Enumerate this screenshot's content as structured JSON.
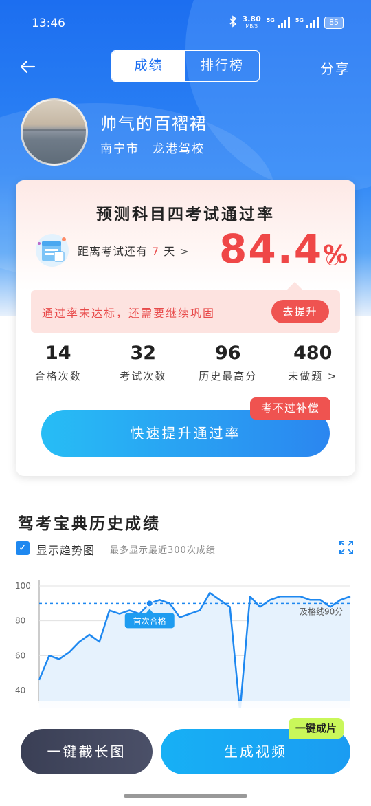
{
  "status_bar": {
    "time": "13:46",
    "net_speed": "3.80",
    "net_unit": "MB/S",
    "signal1_label": "5G",
    "signal2_label": "5G",
    "battery": "85"
  },
  "nav": {
    "tabs": [
      {
        "label": "成绩",
        "active": true
      },
      {
        "label": "排行榜",
        "active": false
      }
    ],
    "share_label": "分享"
  },
  "profile": {
    "name": "帅气的百褶裙",
    "location": "南宁市　龙港驾校"
  },
  "card": {
    "title": "预测科目四考试通过率",
    "countdown_prefix": "距离考试还有",
    "countdown_days": "7",
    "countdown_suffix": "天",
    "pass_rate": "84.4",
    "pass_rate_unit": "%",
    "warning_text": "通过率未达标，还需要继续巩固",
    "improve_button": "去提升",
    "stats": [
      {
        "value": "14",
        "label": "合格次数"
      },
      {
        "value": "32",
        "label": "考试次数"
      },
      {
        "value": "96",
        "label": "历史最高分"
      },
      {
        "value": "480",
        "label": "未做题"
      }
    ],
    "compensation_badge": "考不过补偿",
    "cta_label": "快速提升通过率"
  },
  "history": {
    "title": "驾考宝典历史成绩",
    "show_trend_label": "显示趋势图",
    "show_trend_checked": true,
    "note": "最多显示最近300次成绩"
  },
  "chart_data": {
    "type": "area",
    "y_ticks": [
      "100",
      "80",
      "60",
      "40"
    ],
    "ylim": [
      35,
      100
    ],
    "pass_line": 90,
    "pass_line_label": "及格线90分",
    "first_pass_label": "首次合格",
    "first_pass_index": 11,
    "values": [
      46,
      60,
      58,
      62,
      68,
      72,
      68,
      86,
      84,
      86,
      84,
      90,
      92,
      90,
      82,
      84,
      86,
      96,
      92,
      88,
      28,
      94,
      88,
      92,
      94,
      94,
      94,
      92,
      92,
      88,
      92,
      94
    ],
    "colors": {
      "line": "#1e88f0",
      "fill": "#e6f2fd",
      "pass_line": "#1e88f0",
      "grid": "#e0e0e0"
    }
  },
  "bottom": {
    "long_screenshot_label": "一键截长图",
    "video_label": "生成视频",
    "video_badge": "一键成片"
  },
  "colors": {
    "primary": "#1c6ef0",
    "danger": "#ef4747"
  }
}
